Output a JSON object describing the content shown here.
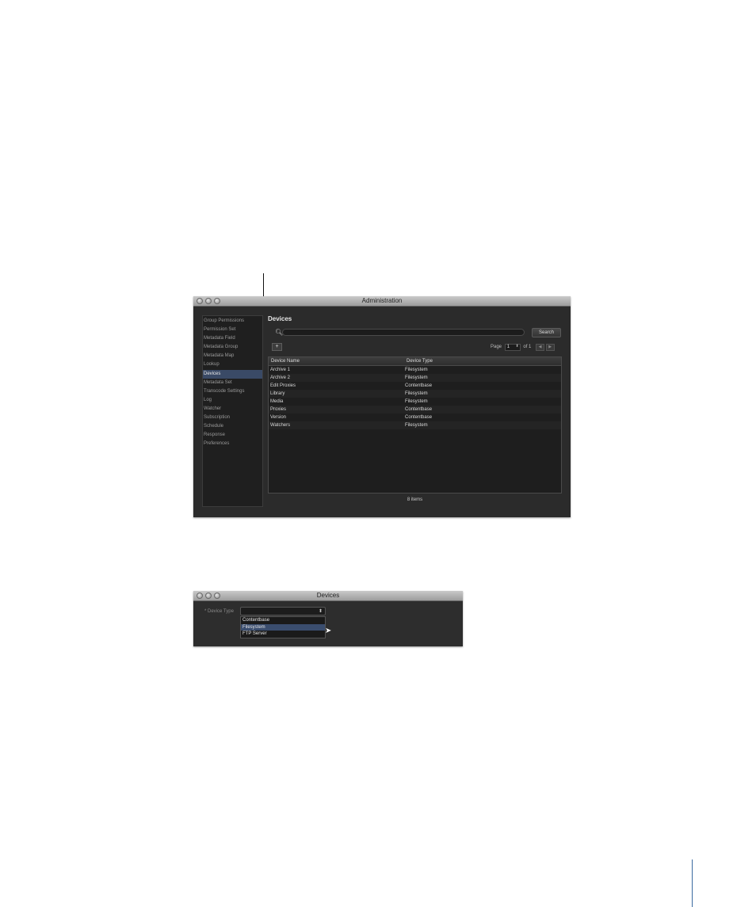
{
  "admin_window": {
    "title": "Administration",
    "sidebar": [
      {
        "label": "Group Permissions",
        "selected": false
      },
      {
        "label": "Permission Set",
        "selected": false
      },
      {
        "label": "Metadata Field",
        "selected": false
      },
      {
        "label": "Metadata Group",
        "selected": false
      },
      {
        "label": "Metadata Map",
        "selected": false
      },
      {
        "label": "Lookup",
        "selected": false
      },
      {
        "label": "Devices",
        "selected": true
      },
      {
        "label": "Metadata Set",
        "selected": false
      },
      {
        "label": "Transcode Settings",
        "selected": false
      },
      {
        "label": "Log",
        "selected": false
      },
      {
        "label": "Watcher",
        "selected": false
      },
      {
        "label": "Subscription",
        "selected": false
      },
      {
        "label": "Schedule",
        "selected": false
      },
      {
        "label": "Response",
        "selected": false
      },
      {
        "label": "Preferences",
        "selected": false
      }
    ],
    "heading": "Devices",
    "search": {
      "placeholder": "",
      "button_label": "Search",
      "icon": "magnifier-icon"
    },
    "add_icon": "add-device-icon",
    "pager": {
      "page_label": "Page",
      "page_value": "1",
      "of_label": "of 1",
      "prev_glyph": "◀",
      "next_glyph": "▶"
    },
    "table": {
      "columns": [
        "Device Name",
        "Device Type"
      ],
      "rows": [
        [
          "Archive 1",
          "Filesystem"
        ],
        [
          "Archive 2",
          "Filesystem"
        ],
        [
          "Edit Proxies",
          "Contentbase"
        ],
        [
          "Library",
          "Filesystem"
        ],
        [
          "Media",
          "Filesystem"
        ],
        [
          "Proxies",
          "Contentbase"
        ],
        [
          "Version",
          "Contentbase"
        ],
        [
          "Watchers",
          "Filesystem"
        ]
      ]
    },
    "item_count": "8 items"
  },
  "devices_window": {
    "title": "Devices",
    "device_type_label": "* Device Type",
    "options": [
      {
        "label": "Contentbase",
        "selected": false
      },
      {
        "label": "Filesystem",
        "selected": true
      },
      {
        "label": "FTP Server",
        "selected": false
      }
    ]
  },
  "colors": {
    "window_bg": "#2b2b2b",
    "selection": "#3a4a66",
    "page_rule": "#3a6aa0"
  }
}
